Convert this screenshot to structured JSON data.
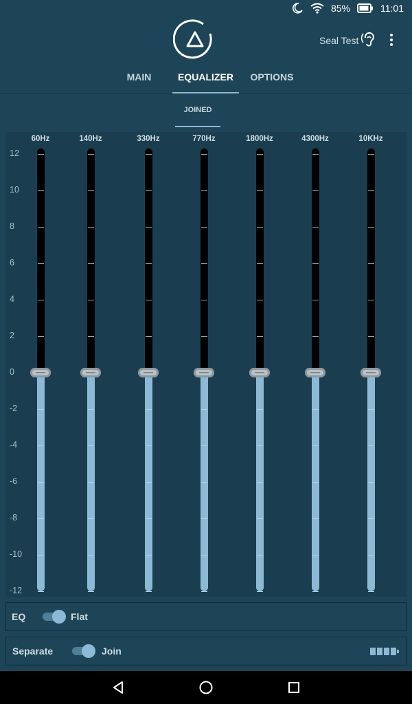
{
  "status": {
    "battery_pct": "85%",
    "time": "11:01"
  },
  "header": {
    "device_name": "Seal Test",
    "tabs": [
      {
        "label": "MAIN"
      },
      {
        "label": "EQUALIZER"
      },
      {
        "label": "OPTIONS"
      }
    ],
    "active_tab": "EQUALIZER"
  },
  "subtabs": {
    "label": "JOINED"
  },
  "equalizer": {
    "bands": [
      {
        "label": "60Hz",
        "gain_db": 0
      },
      {
        "label": "140Hz",
        "gain_db": 0
      },
      {
        "label": "330Hz",
        "gain_db": 0
      },
      {
        "label": "770Hz",
        "gain_db": 0
      },
      {
        "label": "1800Hz",
        "gain_db": 0
      },
      {
        "label": "4300Hz",
        "gain_db": 0
      },
      {
        "label": "10KHz",
        "gain_db": 0
      }
    ],
    "scale_labels": [
      "12",
      "10",
      "8",
      "6",
      "4",
      "2",
      "0",
      "-2",
      "-4",
      "-6",
      "-8",
      "-10",
      "-12"
    ],
    "range_db": [
      -12,
      12
    ]
  },
  "controls": {
    "eq_label": "EQ",
    "eq_value": "Flat",
    "eq_enabled": true,
    "mode_label": "Separate",
    "mode_value": "Join",
    "mode_join": true
  },
  "colors": {
    "background": "#1e4557",
    "accent": "#8cbad6",
    "track": "#000000"
  },
  "icons": {
    "moon": "night-mode-icon",
    "wifi": "wifi-icon",
    "battery": "battery-icon",
    "hearing": "hearing-icon",
    "menu": "more-vert-icon",
    "back": "back-icon",
    "home": "home-icon",
    "recents": "recents-icon"
  }
}
